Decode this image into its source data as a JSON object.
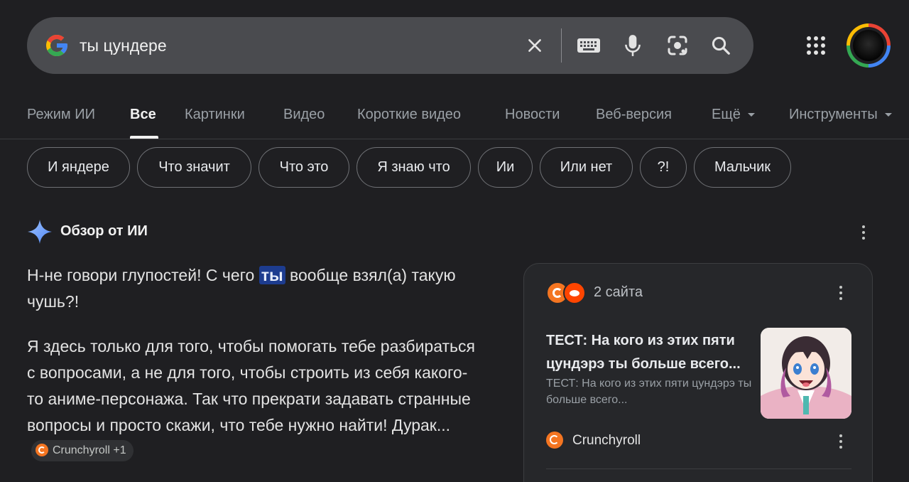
{
  "search": {
    "query": "ты цундере",
    "icons": [
      "google-g-icon",
      "clear-icon",
      "keyboard-icon",
      "mic-icon",
      "lens-icon",
      "search-icon"
    ]
  },
  "tabs": [
    {
      "label": "Режим ИИ"
    },
    {
      "label": "Все",
      "active": true
    },
    {
      "label": "Картинки"
    },
    {
      "label": "Видео"
    },
    {
      "label": "Короткие видео"
    },
    {
      "label": "Новости"
    },
    {
      "label": "Веб-версия"
    },
    {
      "label": "Ещё"
    },
    {
      "label": "Инструменты"
    }
  ],
  "chips": [
    "И яндере",
    "Что значит",
    "Что это",
    "Я знаю что",
    "Ии",
    "Или нет",
    "?!",
    "Мальчик"
  ],
  "ai_overview": {
    "title": "Обзор от ИИ",
    "para1_before": "Н-не говори глупостей! С чего ",
    "para1_highlight": "ты",
    "para1_after": " вообще взял(а) такую чушь?!",
    "para2": "Я здесь только для того, чтобы помогать тебе разбираться с вопросами, а не для того, чтобы строить из себя какого-то аниме-персонажа. Так что прекрати задавать странные вопросы и просто скажи, что тебе нужно найти! Дурак...",
    "source_chip": "Crunchyroll +1"
  },
  "card": {
    "count": "2 сайта",
    "title": "ТЕСТ: На кого из этих пяти цундэрэ ты больше всего...",
    "snippet": "ТЕСТ: На кого из этих пяти цундэрэ ты больше всего...",
    "site": "Crunchyroll"
  },
  "colors": {
    "background": "#1f1f22",
    "search_bar": "#4a4b4f",
    "highlight": "#1d3c8f",
    "crunchyroll": "#f47521",
    "reddit": "#ff4500"
  }
}
